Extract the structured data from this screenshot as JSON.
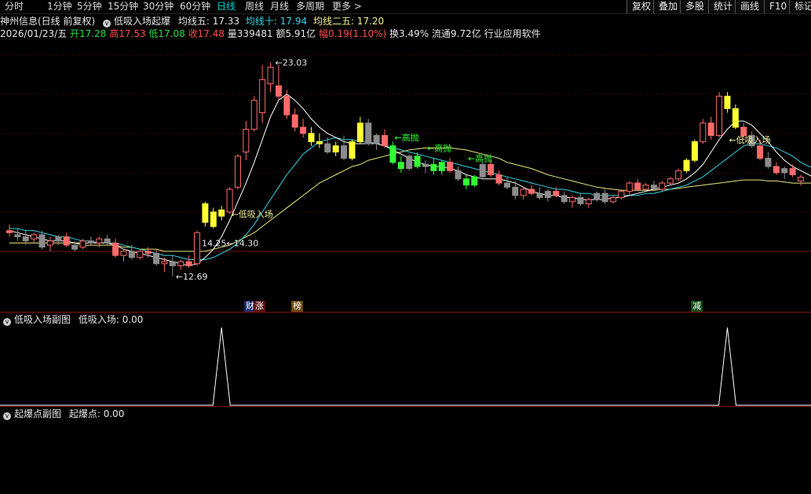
{
  "toolbar": {
    "periods": [
      "分时",
      "1分钟",
      "5分钟",
      "15分钟",
      "30分钟",
      "60分钟",
      "日线",
      "周线",
      "月线",
      "多周期",
      "更多 >"
    ],
    "active_period": "日线",
    "right_buttons": [
      "复权",
      "叠加",
      "多股",
      "统计",
      "画线",
      "F10",
      "标记"
    ]
  },
  "header": {
    "title": "神州信息(日线 前复权)",
    "indicator_name": "低吸入场起爆",
    "ma5_label": "均线五: 17.33",
    "ma10_label": "均线十: 17.94",
    "ma20_label": "均线二五: 17.20"
  },
  "quote": {
    "date": "2026/01/23/五",
    "open": "开17.28",
    "high": "高17.53",
    "low": "低17.08",
    "close": "收17.48",
    "volume": "量339481",
    "amount": "额5.91亿",
    "change": "幅0.19(1.10%)",
    "turnover": "换3.49%",
    "float": "流通9.72亿",
    "industry": "行业应用软件"
  },
  "chart_data": {
    "type": "candlestick",
    "price_labels": {
      "high_peak": "23.03",
      "low_trough": "12.69",
      "level_a": "14.25",
      "level_b": "14.30"
    },
    "annotations": [
      "低吸入场",
      "高抛",
      "高抛",
      "高抛",
      "低吸入场"
    ],
    "event_markers": [
      "财",
      "涨",
      "榜",
      "减"
    ],
    "candles": [
      {
        "o": 14.9,
        "h": 15.2,
        "l": 14.6,
        "c": 14.8
      },
      {
        "o": 14.7,
        "h": 15.0,
        "l": 14.4,
        "c": 14.6
      },
      {
        "o": 14.6,
        "h": 14.9,
        "l": 14.2,
        "c": 14.4
      },
      {
        "o": 14.5,
        "h": 14.8,
        "l": 14.3,
        "c": 14.7
      },
      {
        "o": 14.7,
        "h": 14.9,
        "l": 14.0,
        "c": 14.1
      },
      {
        "o": 14.2,
        "h": 14.6,
        "l": 13.9,
        "c": 14.4
      },
      {
        "o": 14.4,
        "h": 14.7,
        "l": 14.2,
        "c": 14.6
      },
      {
        "o": 14.6,
        "h": 14.8,
        "l": 14.1,
        "c": 14.2
      },
      {
        "o": 14.2,
        "h": 14.4,
        "l": 13.9,
        "c": 14.0
      },
      {
        "o": 14.1,
        "h": 14.5,
        "l": 14.0,
        "c": 14.4
      },
      {
        "o": 14.4,
        "h": 14.6,
        "l": 14.2,
        "c": 14.3
      },
      {
        "o": 14.3,
        "h": 14.6,
        "l": 14.1,
        "c": 14.5
      },
      {
        "o": 14.5,
        "h": 14.7,
        "l": 14.2,
        "c": 14.3
      },
      {
        "o": 14.3,
        "h": 14.5,
        "l": 13.6,
        "c": 13.7
      },
      {
        "o": 13.7,
        "h": 14.0,
        "l": 13.4,
        "c": 13.9
      },
      {
        "o": 13.9,
        "h": 14.2,
        "l": 13.5,
        "c": 13.6
      },
      {
        "o": 13.6,
        "h": 14.0,
        "l": 13.5,
        "c": 13.9
      },
      {
        "o": 13.9,
        "h": 14.1,
        "l": 13.6,
        "c": 13.8
      },
      {
        "o": 13.8,
        "h": 14.0,
        "l": 13.2,
        "c": 13.3
      },
      {
        "o": 13.3,
        "h": 13.6,
        "l": 12.9,
        "c": 13.4
      },
      {
        "o": 13.4,
        "h": 13.7,
        "l": 12.69,
        "c": 13.2
      },
      {
        "o": 13.2,
        "h": 13.5,
        "l": 13.0,
        "c": 13.4
      },
      {
        "o": 13.4,
        "h": 13.7,
        "l": 13.1,
        "c": 13.2
      },
      {
        "o": 13.3,
        "h": 14.9,
        "l": 13.2,
        "c": 14.8
      },
      {
        "o": 16.2,
        "h": 16.3,
        "l": 15.1,
        "c": 15.3
      },
      {
        "o": 15.8,
        "h": 16.0,
        "l": 15.0,
        "c": 15.1
      },
      {
        "o": 15.6,
        "h": 16.1,
        "l": 15.4,
        "c": 15.9
      },
      {
        "o": 15.8,
        "h": 17.0,
        "l": 15.7,
        "c": 16.9
      },
      {
        "o": 17.0,
        "h": 18.6,
        "l": 16.9,
        "c": 18.5
      },
      {
        "o": 18.7,
        "h": 20.2,
        "l": 18.3,
        "c": 19.8
      },
      {
        "o": 19.8,
        "h": 21.4,
        "l": 19.7,
        "c": 21.2
      },
      {
        "o": 20.6,
        "h": 22.9,
        "l": 20.1,
        "c": 22.2
      },
      {
        "o": 22.0,
        "h": 23.03,
        "l": 21.6,
        "c": 22.8
      },
      {
        "o": 21.9,
        "h": 22.9,
        "l": 21.2,
        "c": 21.4
      },
      {
        "o": 21.4,
        "h": 21.7,
        "l": 20.3,
        "c": 20.5
      },
      {
        "o": 20.5,
        "h": 20.8,
        "l": 19.7,
        "c": 19.9
      },
      {
        "o": 19.9,
        "h": 20.3,
        "l": 19.4,
        "c": 19.6
      },
      {
        "o": 19.6,
        "h": 19.9,
        "l": 19.0,
        "c": 19.2
      },
      {
        "o": 19.2,
        "h": 19.6,
        "l": 18.9,
        "c": 19.1
      },
      {
        "o": 19.1,
        "h": 19.4,
        "l": 18.6,
        "c": 18.7
      },
      {
        "o": 18.7,
        "h": 19.2,
        "l": 18.5,
        "c": 19.0
      },
      {
        "o": 19.0,
        "h": 19.5,
        "l": 18.3,
        "c": 18.4
      },
      {
        "o": 18.4,
        "h": 19.3,
        "l": 18.3,
        "c": 19.2
      },
      {
        "o": 19.2,
        "h": 20.4,
        "l": 19.1,
        "c": 20.1
      },
      {
        "o": 20.1,
        "h": 20.3,
        "l": 19.0,
        "c": 19.1
      },
      {
        "o": 19.1,
        "h": 19.6,
        "l": 18.8,
        "c": 19.5
      },
      {
        "o": 19.5,
        "h": 19.8,
        "l": 18.9,
        "c": 19.0
      },
      {
        "o": 19.0,
        "h": 19.2,
        "l": 18.1,
        "c": 18.2
      },
      {
        "o": 18.2,
        "h": 18.5,
        "l": 17.7,
        "c": 17.9
      },
      {
        "o": 17.9,
        "h": 18.6,
        "l": 17.8,
        "c": 18.5
      },
      {
        "o": 18.5,
        "h": 18.7,
        "l": 17.9,
        "c": 18.0
      },
      {
        "o": 18.0,
        "h": 18.3,
        "l": 17.7,
        "c": 18.1
      },
      {
        "o": 18.1,
        "h": 18.4,
        "l": 17.6,
        "c": 17.8
      },
      {
        "o": 17.8,
        "h": 18.3,
        "l": 17.6,
        "c": 18.2
      },
      {
        "o": 18.2,
        "h": 18.4,
        "l": 17.7,
        "c": 17.8
      },
      {
        "o": 17.8,
        "h": 18.0,
        "l": 17.3,
        "c": 17.4
      },
      {
        "o": 17.4,
        "h": 17.6,
        "l": 16.9,
        "c": 17.1
      },
      {
        "o": 17.1,
        "h": 17.6,
        "l": 17.0,
        "c": 17.5
      },
      {
        "o": 17.5,
        "h": 18.2,
        "l": 17.4,
        "c": 18.1
      },
      {
        "o": 18.1,
        "h": 18.3,
        "l": 17.5,
        "c": 17.6
      },
      {
        "o": 17.6,
        "h": 17.8,
        "l": 17.1,
        "c": 17.2
      },
      {
        "o": 17.2,
        "h": 17.5,
        "l": 16.9,
        "c": 17.0
      },
      {
        "o": 17.0,
        "h": 17.3,
        "l": 16.4,
        "c": 16.6
      },
      {
        "o": 16.6,
        "h": 17.0,
        "l": 16.4,
        "c": 16.9
      },
      {
        "o": 16.9,
        "h": 17.1,
        "l": 16.6,
        "c": 16.7
      },
      {
        "o": 16.7,
        "h": 17.0,
        "l": 16.4,
        "c": 16.5
      },
      {
        "o": 16.5,
        "h": 16.9,
        "l": 16.3,
        "c": 16.8
      },
      {
        "o": 16.8,
        "h": 17.0,
        "l": 16.5,
        "c": 16.6
      },
      {
        "o": 16.6,
        "h": 16.8,
        "l": 16.2,
        "c": 16.3
      },
      {
        "o": 16.3,
        "h": 16.6,
        "l": 16.0,
        "c": 16.5
      },
      {
        "o": 16.5,
        "h": 16.7,
        "l": 16.1,
        "c": 16.2
      },
      {
        "o": 16.2,
        "h": 16.5,
        "l": 16.0,
        "c": 16.4
      },
      {
        "o": 16.4,
        "h": 16.8,
        "l": 16.3,
        "c": 16.7
      },
      {
        "o": 16.7,
        "h": 16.9,
        "l": 16.2,
        "c": 16.3
      },
      {
        "o": 16.3,
        "h": 16.6,
        "l": 16.2,
        "c": 16.5
      },
      {
        "o": 16.5,
        "h": 16.9,
        "l": 16.4,
        "c": 16.8
      },
      {
        "o": 16.8,
        "h": 17.3,
        "l": 16.6,
        "c": 17.2
      },
      {
        "o": 17.2,
        "h": 17.4,
        "l": 16.8,
        "c": 16.9
      },
      {
        "o": 16.9,
        "h": 17.2,
        "l": 16.8,
        "c": 17.1
      },
      {
        "o": 17.1,
        "h": 17.3,
        "l": 16.8,
        "c": 16.9
      },
      {
        "o": 16.9,
        "h": 17.3,
        "l": 16.8,
        "c": 17.2
      },
      {
        "o": 17.2,
        "h": 17.5,
        "l": 17.1,
        "c": 17.4
      },
      {
        "o": 17.4,
        "h": 17.9,
        "l": 17.3,
        "c": 17.8
      },
      {
        "o": 17.8,
        "h": 18.4,
        "l": 17.7,
        "c": 18.3
      },
      {
        "o": 18.3,
        "h": 19.3,
        "l": 18.2,
        "c": 19.2
      },
      {
        "o": 19.2,
        "h": 20.3,
        "l": 19.1,
        "c": 20.1
      },
      {
        "o": 20.1,
        "h": 20.4,
        "l": 19.3,
        "c": 19.5
      },
      {
        "o": 19.5,
        "h": 21.6,
        "l": 19.4,
        "c": 21.4
      },
      {
        "o": 21.4,
        "h": 21.6,
        "l": 20.6,
        "c": 20.8
      },
      {
        "o": 20.8,
        "h": 21.0,
        "l": 19.8,
        "c": 19.9
      },
      {
        "o": 19.9,
        "h": 20.1,
        "l": 19.3,
        "c": 19.5
      },
      {
        "o": 19.5,
        "h": 19.7,
        "l": 18.9,
        "c": 19.0
      },
      {
        "o": 19.0,
        "h": 19.3,
        "l": 18.3,
        "c": 18.4
      },
      {
        "o": 18.4,
        "h": 18.7,
        "l": 17.9,
        "c": 18.0
      },
      {
        "o": 18.0,
        "h": 18.2,
        "l": 17.6,
        "c": 17.7
      },
      {
        "o": 17.7,
        "h": 18.0,
        "l": 17.4,
        "c": 17.9
      },
      {
        "o": 17.9,
        "h": 18.1,
        "l": 17.5,
        "c": 17.6
      },
      {
        "o": 17.3,
        "h": 17.6,
        "l": 17.08,
        "c": 17.48
      }
    ],
    "candle_colors": [
      "red",
      "gray",
      "gray",
      "red",
      "gray",
      "red",
      "gray",
      "red",
      "gray",
      "red",
      "gray",
      "red",
      "gray",
      "red",
      "red",
      "gray",
      "red",
      "red",
      "gray",
      "red",
      "gray",
      "red",
      "red",
      "red",
      "yellow",
      "yellow",
      "yellow",
      "red",
      "red",
      "red",
      "red",
      "red",
      "red",
      "red",
      "red",
      "red",
      "red",
      "yellow",
      "yellow",
      "gray",
      "yellow",
      "gray",
      "yellow",
      "yellow",
      "gray",
      "gray",
      "red",
      "green",
      "green",
      "gray",
      "green",
      "gray",
      "green",
      "green",
      "red",
      "gray",
      "green",
      "green",
      "gray",
      "red",
      "red",
      "gray",
      "gray",
      "red",
      "red",
      "gray",
      "gray",
      "red",
      "gray",
      "red",
      "gray",
      "red",
      "gray",
      "gray",
      "red",
      "red",
      "red",
      "red",
      "red",
      "gray",
      "red",
      "red",
      "red",
      "yellow",
      "yellow",
      "red",
      "red",
      "red",
      "yellow",
      "yellow",
      "red",
      "gray",
      "red",
      "gray",
      "red",
      "gray",
      "red",
      "red"
    ],
    "ma5": [
      14.9,
      14.8,
      14.7,
      14.6,
      14.5,
      14.4,
      14.4,
      14.4,
      14.3,
      14.3,
      14.3,
      14.3,
      14.3,
      14.2,
      14.0,
      13.9,
      13.8,
      13.7,
      13.6,
      13.5,
      13.4,
      13.3,
      13.2,
      13.3,
      13.6,
      14.0,
      14.6,
      15.4,
      16.3,
      17.2,
      18.2,
      19.3,
      20.4,
      21.2,
      21.5,
      21.2,
      20.8,
      20.3,
      19.9,
      19.6,
      19.4,
      19.2,
      19.1,
      19.1,
      19.1,
      19.1,
      19.0,
      18.8,
      18.6,
      18.4,
      18.2,
      18.1,
      18.0,
      18.0,
      17.9,
      17.8,
      17.6,
      17.5,
      17.4,
      17.4,
      17.4,
      17.3,
      17.2,
      17.0,
      16.8,
      16.7,
      16.6,
      16.6,
      16.5,
      16.5,
      16.4,
      16.4,
      16.4,
      16.4,
      16.5,
      16.5,
      16.6,
      16.7,
      16.8,
      16.9,
      17.0,
      17.1,
      17.2,
      17.4,
      17.7,
      18.1,
      18.7,
      19.3,
      19.8,
      20.2,
      20.2,
      20.0,
      19.6,
      19.2,
      18.7,
      18.3,
      18.0,
      17.8,
      17.6,
      17.33
    ],
    "ma10": [
      15.0,
      15.0,
      14.9,
      14.9,
      14.8,
      14.7,
      14.6,
      14.6,
      14.5,
      14.4,
      14.4,
      14.3,
      14.3,
      14.3,
      14.2,
      14.1,
      14.0,
      13.9,
      13.8,
      13.7,
      13.7,
      13.6,
      13.5,
      13.5,
      13.5,
      13.6,
      13.8,
      14.0,
      14.3,
      14.7,
      15.2,
      15.8,
      16.4,
      17.0,
      17.6,
      18.1,
      18.6,
      18.9,
      19.2,
      19.3,
      19.4,
      19.3,
      19.3,
      19.2,
      19.2,
      19.1,
      19.0,
      18.9,
      18.8,
      18.7,
      18.6,
      18.5,
      18.4,
      18.3,
      18.2,
      18.1,
      18.0,
      17.9,
      17.8,
      17.7,
      17.6,
      17.5,
      17.4,
      17.3,
      17.2,
      17.1,
      17.0,
      16.9,
      16.9,
      16.8,
      16.7,
      16.7,
      16.6,
      16.6,
      16.6,
      16.6,
      16.6,
      16.6,
      16.7,
      16.7,
      16.8,
      16.9,
      17.0,
      17.1,
      17.3,
      17.5,
      17.8,
      18.1,
      18.4,
      18.7,
      19.0,
      19.1,
      19.1,
      19.0,
      18.9,
      18.7,
      18.5,
      18.2,
      18.0,
      17.94
    ],
    "ma25": [
      14.3,
      14.3,
      14.3,
      14.3,
      14.3,
      14.3,
      14.3,
      14.3,
      14.3,
      14.2,
      14.2,
      14.2,
      14.2,
      14.2,
      14.1,
      14.1,
      14.0,
      14.0,
      14.0,
      13.9,
      13.9,
      13.9,
      13.9,
      13.9,
      13.9,
      14.0,
      14.1,
      14.2,
      14.4,
      14.6,
      14.8,
      15.1,
      15.4,
      15.7,
      16.0,
      16.3,
      16.6,
      16.9,
      17.2,
      17.4,
      17.6,
      17.8,
      18.0,
      18.1,
      18.3,
      18.4,
      18.5,
      18.6,
      18.7,
      18.8,
      18.85,
      18.9,
      18.9,
      18.9,
      18.9,
      18.85,
      18.8,
      18.7,
      18.6,
      18.5,
      18.4,
      18.2,
      18.1,
      18.0,
      17.9,
      17.75,
      17.6,
      17.5,
      17.4,
      17.3,
      17.2,
      17.1,
      17.0,
      16.95,
      16.9,
      16.85,
      16.85,
      16.85,
      16.85,
      16.85,
      16.9,
      16.9,
      16.95,
      17.0,
      17.05,
      17.1,
      17.15,
      17.2,
      17.25,
      17.3,
      17.35,
      17.35,
      17.35,
      17.3,
      17.3,
      17.25,
      17.2,
      17.2,
      17.2,
      17.2
    ]
  },
  "sub1": {
    "title": "低吸入场副图",
    "value_label": "低吸入场: 0.00",
    "spikes": [
      {
        "index": 26,
        "value": 1
      },
      {
        "index": 88,
        "value": 1
      }
    ]
  },
  "sub2": {
    "title": "起爆点副图",
    "value_label": "起爆点: 0.00"
  },
  "colors": {
    "up": "#ff6a6a",
    "down_fill": "#8c8c8c",
    "yellow": "#ffff33",
    "green": "#33ff33",
    "ma5": "#ffffff",
    "ma10": "#33d6e6",
    "ma25": "#e8e87a",
    "divider": "#8a1010"
  }
}
